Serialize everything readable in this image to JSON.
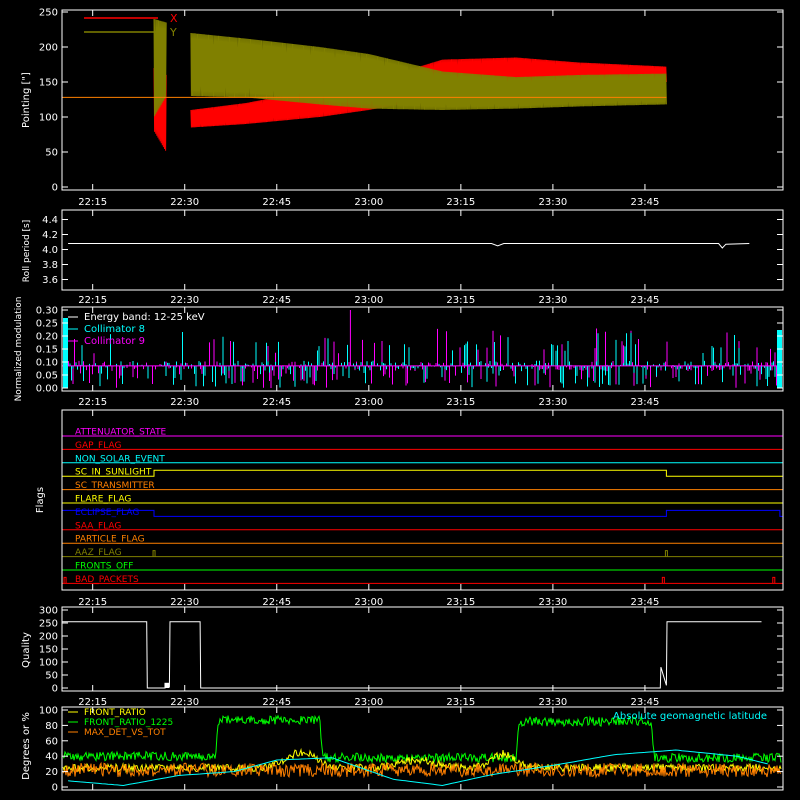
{
  "chart_data": [
    {
      "type": "line",
      "ylabel": "Pointing [\"]",
      "xticks": [
        "22:15",
        "22:30",
        "22:45",
        "23:00",
        "23:15",
        "23:30",
        "23:45"
      ],
      "xlim_minutes": [
        1330,
        1430
      ],
      "ylim": [
        0,
        250
      ],
      "yticks": [
        "0",
        "50",
        "100",
        "150",
        "200",
        "250"
      ],
      "legend_placement": "top-left",
      "series": [
        {
          "name": "X",
          "color": "#ff0000",
          "segments": [
            {
              "x": [
                1345.0,
                1347.0
              ],
              "upper": [
                170,
                160
              ],
              "lower": [
                80,
                50
              ]
            },
            {
              "x": [
                1351.0,
                1360.0,
                1372.0,
                1380.0,
                1392.0,
                1404.0,
                1414.0,
                1428.5
              ],
              "upper": [
                110,
                120,
                140,
                150,
                182,
                185,
                178,
                172
              ],
              "lower": [
                85,
                90,
                100,
                110,
                130,
                145,
                148,
                150
              ]
            }
          ]
        },
        {
          "name": "Y",
          "color": "#808000",
          "segments": [
            {
              "x": [
                1345.0,
                1347.0
              ],
              "upper": [
                240,
                235
              ],
              "lower": [
                100,
                130
              ]
            },
            {
              "x": [
                1351.0,
                1360.0,
                1372.0,
                1380.0,
                1392.0,
                1404.0,
                1414.0,
                1428.5
              ],
              "upper": [
                220,
                212,
                200,
                190,
                165,
                157,
                160,
                162
              ],
              "lower": [
                130,
                128,
                118,
                112,
                110,
                112,
                115,
                118
              ]
            }
          ]
        }
      ],
      "baseline_value": 128,
      "baseline_x": [
        1330,
        1428.5
      ]
    },
    {
      "type": "line",
      "ylabel": "Roll period [s]",
      "xticks": [
        "22:15",
        "22:30",
        "22:45",
        "23:00",
        "23:15",
        "23:30",
        "23:45"
      ],
      "ylim": [
        3.5,
        4.5
      ],
      "yticks": [
        "3.6",
        "3.8",
        "4.0",
        "4.2",
        "4.4"
      ],
      "series": [
        {
          "color": "#ffffff",
          "x": [
            1331,
            1360,
            1390,
            1400,
            1401,
            1402,
            1420,
            1437,
            1437.6,
            1438.2,
            1442
          ],
          "y": [
            4.08,
            4.08,
            4.08,
            4.08,
            4.05,
            4.08,
            4.08,
            4.08,
            4.02,
            4.07,
            4.08
          ]
        }
      ]
    },
    {
      "type": "bar",
      "ylabel": "Normalized modulation",
      "xticks": [
        "22:15",
        "22:30",
        "22:45",
        "23:00",
        "23:15",
        "23:30",
        "23:45"
      ],
      "ylim": [
        0,
        0.3
      ],
      "yticks": [
        "0.00",
        "0.05",
        "0.10",
        "0.15",
        "0.20",
        "0.25",
        "0.30"
      ],
      "annotation": "Energy band: 12-25 keV",
      "legend_placement": "top-left",
      "baseline_value": 0.085,
      "series": [
        {
          "name": "Collimator 8",
          "color": "#00ffff",
          "description": "spiky modulation around 0.085, peaks to about 0.22"
        },
        {
          "name": "Collimator 9",
          "color": "#ff00ff",
          "description": "spiky modulation around 0.085, peaks to about 0.30 near 22:45"
        }
      ]
    },
    {
      "type": "line",
      "ylabel": "Flags",
      "xticks": [
        "22:15",
        "22:30",
        "22:45",
        "23:00",
        "23:15",
        "23:30",
        "23:45"
      ],
      "flags": [
        {
          "name": "ATTENUATOR_STATE",
          "color": "#ff00ff",
          "events": []
        },
        {
          "name": "GAP_FLAG",
          "color": "#ff0000",
          "events": []
        },
        {
          "name": "NON_SOLAR_EVENT",
          "color": "#00ffff",
          "events": []
        },
        {
          "name": "SC_IN_SUNLIGHT",
          "color": "#ffff00",
          "high_intervals": [
            [
              1345.0,
              1428.5
            ]
          ]
        },
        {
          "name": "SC_TRANSMITTER",
          "color": "#ff8000",
          "events": []
        },
        {
          "name": "FLARE_FLAG",
          "color": "#ffff00",
          "events": []
        },
        {
          "name": "ECLIPSE_FLAG",
          "color": "#0000ff",
          "high_intervals": [
            [
              1330,
              1345.0
            ],
            [
              1428.5,
              1447
            ]
          ]
        },
        {
          "name": "SAA_FLAG",
          "color": "#ff0000",
          "events": []
        },
        {
          "name": "PARTICLE_FLAG",
          "color": "#ff8000",
          "events": []
        },
        {
          "name": "AAZ_FLAG",
          "color": "#808000",
          "pulses": [
            1345.0,
            1428.5
          ]
        },
        {
          "name": "FRONTS_OFF",
          "color": "#00ff00",
          "events": []
        },
        {
          "name": "BAD_PACKETS",
          "color": "#ff0000",
          "pulses": [
            1330.5,
            1428.0,
            1446.0
          ]
        }
      ]
    },
    {
      "type": "line",
      "ylabel": "Quality",
      "xticks": [
        "22:15",
        "22:30",
        "22:45",
        "23:00",
        "23:15",
        "23:30",
        "23:45"
      ],
      "ylim": [
        0,
        300
      ],
      "yticks": [
        "0",
        "50",
        "100",
        "150",
        "200",
        "250",
        "300"
      ],
      "series": [
        {
          "color": "#ffffff",
          "x": [
            1330,
            1343.8,
            1343.9,
            1345.0,
            1346.8,
            1347.0,
            1347.5,
            1347.6,
            1352.5,
            1352.6,
            1353.5,
            1427.5,
            1427.6,
            1428.5,
            1428.6,
            1444
          ],
          "y": [
            255,
            255,
            0,
            0,
            0,
            5,
            5,
            255,
            255,
            0,
            0,
            0,
            80,
            10,
            255,
            255
          ]
        }
      ]
    },
    {
      "type": "line",
      "ylabel": "Degrees or %",
      "ylim": [
        0,
        100
      ],
      "yticks": [
        "0",
        "20",
        "40",
        "60",
        "80",
        "100"
      ],
      "legend_placement": "top-left",
      "annotation": "Absolute geomagnetic latitude",
      "series": [
        {
          "name": "FRONT_RATIO",
          "color": "#ffff00",
          "description": "noisy around 25, broad humps to about 45 near 22:40 and 22:58"
        },
        {
          "name": "FRONT_RATIO_1225",
          "color": "#00ff00",
          "x": [
            1330,
            1355,
            1355.5,
            1372,
            1372.5,
            1404,
            1404.5,
            1426,
            1426.5,
            1447
          ],
          "level": [
            40,
            40,
            87,
            87,
            38,
            38,
            85,
            85,
            38,
            38
          ]
        },
        {
          "name": "MAX_DET_VS_TOT",
          "color": "#ff8000",
          "description": "noisy around 22, range about 10-35"
        },
        {
          "name": "Absolute geomagnetic latitude",
          "color": "#00ffff",
          "x": [
            1331,
            1340,
            1349,
            1358,
            1365,
            1374,
            1384,
            1392,
            1400,
            1410,
            1420,
            1430,
            1440,
            1445
          ],
          "y": [
            8,
            2,
            15,
            20,
            35,
            38,
            10,
            2,
            16,
            28,
            42,
            48,
            40,
            30
          ]
        }
      ]
    }
  ]
}
